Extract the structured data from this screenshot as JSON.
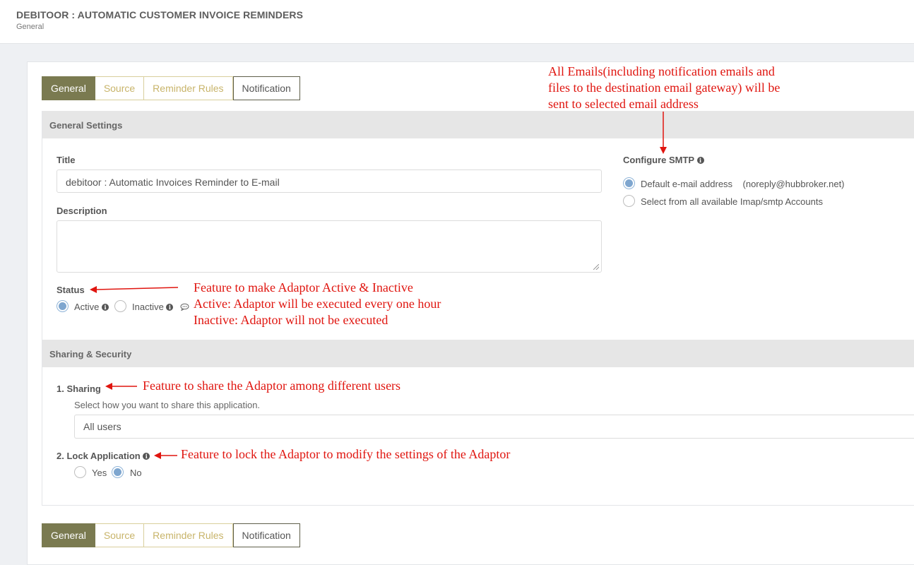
{
  "header": {
    "title": "DEBITOOR : AUTOMATIC CUSTOMER INVOICE REMINDERS",
    "subtitle": "General"
  },
  "tabs": [
    {
      "label": "General",
      "active": true
    },
    {
      "label": "Source",
      "active": false
    },
    {
      "label": "Reminder Rules",
      "active": false
    },
    {
      "label": "Notification",
      "active": false
    }
  ],
  "general": {
    "section_title": "General Settings",
    "title_label": "Title",
    "title_value": "debitoor : Automatic Invoices Reminder to E-mail",
    "description_label": "Description",
    "description_value": "",
    "status_label": "Status",
    "status_active": "Active",
    "status_inactive": "Inactive",
    "status_selected": "Active"
  },
  "smtp": {
    "label": "Configure SMTP",
    "option_default": "Default e-mail address",
    "option_default_email": "(noreply@hubbroker.net)",
    "option_all": "Select from all available Imap/smtp Accounts",
    "selected": "default"
  },
  "sharing": {
    "section_title": "Sharing & Security",
    "sharing_label": "1. Sharing",
    "sharing_help": "Select how you want to share this application.",
    "sharing_value": "All users",
    "lock_label": "2. Lock Application",
    "lock_yes": "Yes",
    "lock_no": "No",
    "lock_selected": "No"
  },
  "annotations": {
    "smtp_note": [
      "All Emails(including notification emails and",
      "files to the destination email gateway) will be",
      "sent to selected email address"
    ],
    "status_note": [
      "Feature to make Adaptor Active & Inactive",
      "Active: Adaptor will be executed every one hour",
      "Inactive: Adaptor will not be executed"
    ],
    "sharing_note": "Feature to share the Adaptor among different users",
    "lock_note": "Feature to lock the Adaptor to modify the settings of the Adaptor"
  },
  "colors": {
    "tab_active_bg": "#7a7a50",
    "tab_inactive_text": "#c8b46a",
    "annotation": "#e0150f",
    "radio_checked": "#7ea6cf"
  }
}
